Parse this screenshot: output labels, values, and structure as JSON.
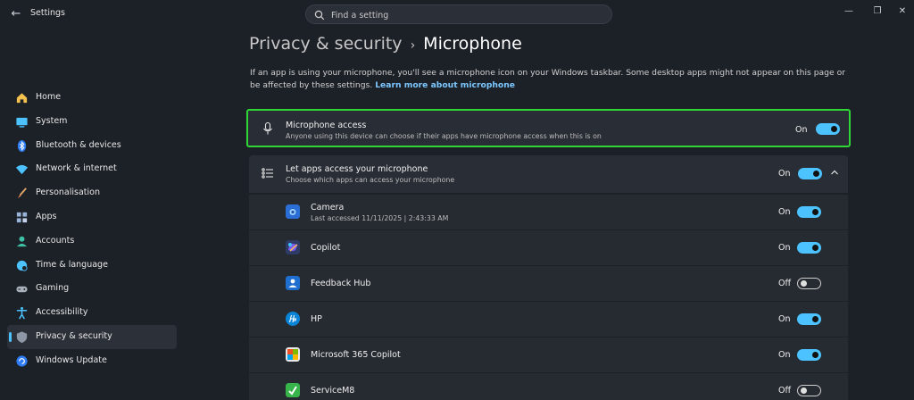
{
  "window": {
    "title": "Settings",
    "back_glyph": "←",
    "min_glyph": "—",
    "max_glyph": "❐",
    "close_glyph": "✕"
  },
  "search": {
    "placeholder": "Find a setting"
  },
  "sidebar": {
    "items": [
      {
        "label": "Home",
        "icon": "home-icon"
      },
      {
        "label": "System",
        "icon": "system-icon"
      },
      {
        "label": "Bluetooth & devices",
        "icon": "bluetooth-icon"
      },
      {
        "label": "Network & internet",
        "icon": "network-icon"
      },
      {
        "label": "Personalisation",
        "icon": "brush-icon"
      },
      {
        "label": "Apps",
        "icon": "apps-icon"
      },
      {
        "label": "Accounts",
        "icon": "accounts-icon"
      },
      {
        "label": "Time & language",
        "icon": "globe-icon"
      },
      {
        "label": "Gaming",
        "icon": "gamepad-icon"
      },
      {
        "label": "Accessibility",
        "icon": "accessibility-icon"
      },
      {
        "label": "Privacy & security",
        "icon": "shield-icon",
        "active": true
      },
      {
        "label": "Windows Update",
        "icon": "update-icon"
      }
    ]
  },
  "breadcrumb": {
    "parent": "Privacy & security",
    "separator": "›",
    "current": "Microphone"
  },
  "description": {
    "text": "If an app is using your microphone, you'll see a microphone icon on your Windows taskbar. Some desktop apps might not appear on this page or be affected by these settings.",
    "link": "Learn more about microphone"
  },
  "microphone_access": {
    "title": "Microphone access",
    "subtitle": "Anyone using this device can choose if their apps have microphone access when this is on",
    "state": "On",
    "on": true
  },
  "let_apps": {
    "title": "Let apps access your microphone",
    "subtitle": "Choose which apps can access your microphone",
    "state": "On",
    "on": true
  },
  "apps": [
    {
      "name": "Camera",
      "sub": "Last accessed 11/11/2025  |  2:43:33 AM",
      "state": "On",
      "on": true,
      "icon": "camera-icon",
      "color": "#2b6fd6"
    },
    {
      "name": "Copilot",
      "sub": "",
      "state": "On",
      "on": true,
      "icon": "copilot-icon",
      "color": "#7a5cf0"
    },
    {
      "name": "Feedback Hub",
      "sub": "",
      "state": "Off",
      "on": false,
      "icon": "feedback-hub-icon",
      "color": "#1f6fd1"
    },
    {
      "name": "HP",
      "sub": "",
      "state": "On",
      "on": true,
      "icon": "hp-icon",
      "color": "#0a84d6"
    },
    {
      "name": "Microsoft 365 Copilot",
      "sub": "",
      "state": "On",
      "on": true,
      "icon": "m365-copilot-icon",
      "color": "#d9d9d9"
    },
    {
      "name": "ServiceM8",
      "sub": "",
      "state": "Off",
      "on": false,
      "icon": "servicem8-icon",
      "color": "#38b54a"
    }
  ],
  "colors": {
    "accent": "#4cc2ff",
    "highlight": "#2fd635",
    "background": "#1c2027",
    "card": "#292d35"
  }
}
